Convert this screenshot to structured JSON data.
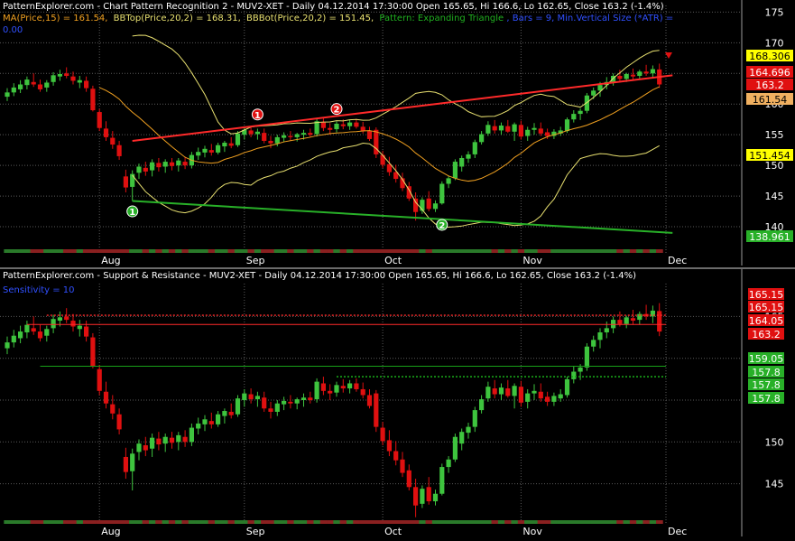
{
  "colors": {
    "background": "#000000",
    "grid": "#5a5a5a",
    "up": "#3ec43e",
    "down": "#e01010",
    "ma": "#f0a020",
    "bands": "#e8e070",
    "resistance": "#ff2a2a",
    "support": "#28b028",
    "flat_level": "#18a018",
    "text_white": "#ffffff",
    "text_gold": "#e8c840",
    "text_green": "#20b020",
    "text_blue": "#3050ff"
  },
  "top": {
    "title": "PatternExplorer.com - Chart Pattern Recognition 2 - MUV2-XET - Daily 04.12.2014 17:30:00 Open 165.65, Hi 166.6, Lo 162.65, Close 163.2 (-1.4%)",
    "ma_label": "MA(Price,15) = 161.54,",
    "bbtop_label": "BBTop(Price,20,2) = 168.31,",
    "bbbot_label": "BBBot(Price,20,2) = 151.45,",
    "pattern_label": "Pattern: Expanding Triangle",
    "bars_label": ", Bars = 9, Min.Vertical Size (*ATR) =",
    "atr_value": "0.00",
    "y_ticks": [
      "175",
      "170",
      "165",
      "160",
      "155",
      "150",
      "145",
      "140"
    ],
    "price_tags": [
      {
        "text": "168.306",
        "bg": "#ffff00",
        "fg": "#000000"
      },
      {
        "text": "164.696",
        "bg": "#e01010",
        "fg": "#ffffff"
      },
      {
        "text": "163.2",
        "bg": "#e01010",
        "fg": "#ffffff"
      },
      {
        "text": "161.54",
        "bg": "#f0b060",
        "fg": "#000000"
      },
      {
        "text": "151.454",
        "bg": "#ffff00",
        "fg": "#000000"
      },
      {
        "text": "138.961",
        "bg": "#28b028",
        "fg": "#ffffff"
      }
    ],
    "markers": [
      {
        "label": "1",
        "color": "#e01010"
      },
      {
        "label": "2",
        "color": "#e01010"
      },
      {
        "label": "1",
        "color": "#28b028"
      },
      {
        "label": "2",
        "color": "#28b028"
      }
    ]
  },
  "bottom": {
    "title": "PatternExplorer.com - Support & Resistance - MUV2-XET - Daily 04.12.2014 17:30:00 Open 165.65, Hi 166.6, Lo 162.65, Close 163.2 (-1.4%)",
    "sensitivity_label": "Sensitivity = 10",
    "y_ticks": [
      "165",
      "160",
      "155",
      "150",
      "145"
    ],
    "price_tags": [
      {
        "text": "165.15",
        "bg": "#e01010",
        "fg": "#ffffff"
      },
      {
        "text": "165.15",
        "bg": "#e01010",
        "fg": "#ffffff"
      },
      {
        "text": "164.05",
        "bg": "#e01010",
        "fg": "#ffffff"
      },
      {
        "text": "163.2",
        "bg": "#e01010",
        "fg": "#ffffff"
      },
      {
        "text": "159.05",
        "bg": "#28b028",
        "fg": "#ffffff"
      },
      {
        "text": "157.8",
        "bg": "#28b028",
        "fg": "#ffffff"
      },
      {
        "text": "157.8",
        "bg": "#28b028",
        "fg": "#ffffff"
      },
      {
        "text": "157.8",
        "bg": "#28b028",
        "fg": "#ffffff"
      }
    ]
  },
  "x_labels": [
    "Aug",
    "Sep",
    "Oct",
    "Nov",
    "Dec"
  ],
  "chart_data": [
    {
      "type": "candlestick",
      "title": "Chart Pattern Recognition 2 - MUV2-XET - Daily",
      "ylim": [
        137.5,
        175.5
      ],
      "x_months": {
        "Aug": 14,
        "Sep": 36,
        "Oct": 57,
        "Nov": 78,
        "Dec": 100
      },
      "series": [
        {
          "name": "MA(Price,15)",
          "last": 161.54
        },
        {
          "name": "BBTop(Price,20,2)",
          "last": 168.31
        },
        {
          "name": "BBBot(Price,20,2)",
          "last": 151.45
        }
      ],
      "resistance_line": {
        "from": [
          19,
          154.0
        ],
        "to": [
          101,
          164.7
        ]
      },
      "support_line": {
        "from": [
          19,
          144.2
        ],
        "to": [
          101,
          139.0
        ]
      },
      "pattern": "Expanding Triangle"
    },
    {
      "type": "candlestick",
      "title": "Support & Resistance - MUV2-XET - Daily",
      "ylim": [
        141.5,
        168.5
      ],
      "levels": [
        {
          "name": "resistance",
          "value": 165.15,
          "style": "dotted"
        },
        {
          "name": "resistance",
          "value": 164.05,
          "style": "solid"
        },
        {
          "name": "support",
          "value": 159.05,
          "style": "solid"
        },
        {
          "name": "support",
          "value": 157.8,
          "style": "dotted"
        }
      ]
    }
  ],
  "ohlc": [
    [
      161.2,
      162.6,
      160.5,
      161.9
    ],
    [
      161.9,
      163.4,
      161.3,
      162.7
    ],
    [
      162.4,
      163.9,
      161.8,
      163.2
    ],
    [
      163.1,
      164.5,
      162.4,
      164.0
    ],
    [
      163.6,
      165.0,
      162.8,
      163.2
    ],
    [
      163.2,
      164.0,
      162.0,
      162.4
    ],
    [
      162.7,
      163.9,
      162.0,
      163.5
    ],
    [
      163.6,
      165.2,
      163.0,
      164.7
    ],
    [
      164.5,
      165.6,
      163.8,
      164.9
    ],
    [
      165.0,
      166.0,
      164.2,
      164.6
    ],
    [
      164.5,
      165.3,
      163.2,
      163.8
    ],
    [
      163.5,
      164.6,
      162.6,
      163.9
    ],
    [
      163.8,
      164.5,
      162.0,
      162.6
    ],
    [
      162.5,
      163.0,
      158.8,
      159.0
    ],
    [
      158.7,
      159.2,
      155.6,
      156.1
    ],
    [
      156.0,
      157.2,
      154.0,
      154.6
    ],
    [
      154.5,
      155.6,
      152.7,
      153.4
    ],
    [
      153.3,
      154.0,
      150.9,
      151.5
    ],
    [
      148.2,
      149.3,
      145.6,
      146.4
    ],
    [
      146.5,
      149.2,
      144.2,
      148.6
    ],
    [
      148.8,
      150.3,
      147.8,
      149.8
    ],
    [
      149.6,
      150.6,
      148.3,
      149.0
    ],
    [
      149.2,
      151.0,
      148.2,
      150.5
    ],
    [
      150.4,
      151.2,
      149.0,
      149.7
    ],
    [
      149.8,
      151.0,
      148.8,
      150.6
    ],
    [
      150.5,
      151.2,
      149.2,
      149.9
    ],
    [
      150.0,
      151.2,
      149.0,
      150.8
    ],
    [
      150.6,
      151.4,
      149.4,
      150.0
    ],
    [
      150.0,
      152.2,
      149.5,
      151.7
    ],
    [
      151.6,
      152.9,
      150.9,
      152.2
    ],
    [
      152.1,
      153.2,
      151.3,
      152.7
    ],
    [
      152.5,
      153.5,
      151.6,
      152.1
    ],
    [
      152.1,
      153.7,
      151.8,
      153.3
    ],
    [
      153.1,
      154.0,
      152.2,
      153.7
    ],
    [
      153.6,
      154.6,
      152.8,
      153.2
    ],
    [
      153.3,
      155.6,
      153.0,
      155.2
    ],
    [
      155.0,
      156.3,
      154.2,
      155.8
    ],
    [
      155.7,
      156.4,
      154.6,
      155.1
    ],
    [
      155.1,
      156.0,
      154.2,
      155.5
    ],
    [
      155.3,
      156.0,
      153.6,
      154.0
    ],
    [
      154.0,
      154.8,
      152.8,
      153.6
    ],
    [
      153.6,
      155.0,
      153.1,
      154.6
    ],
    [
      154.5,
      155.4,
      153.8,
      154.9
    ],
    [
      154.8,
      155.6,
      154.0,
      154.6
    ],
    [
      154.6,
      155.3,
      153.9,
      155.1
    ],
    [
      155.0,
      155.8,
      154.2,
      155.3
    ],
    [
      155.3,
      156.0,
      154.6,
      155.0
    ],
    [
      155.1,
      157.6,
      154.7,
      157.2
    ],
    [
      157.0,
      157.8,
      155.6,
      156.1
    ],
    [
      156.1,
      156.9,
      155.0,
      155.8
    ],
    [
      155.9,
      157.2,
      155.4,
      156.8
    ],
    [
      156.7,
      157.5,
      155.9,
      156.4
    ],
    [
      156.4,
      157.4,
      155.8,
      157.0
    ],
    [
      157.0,
      157.6,
      156.0,
      156.3
    ],
    [
      156.3,
      157.1,
      155.2,
      155.6
    ],
    [
      155.6,
      156.3,
      154.0,
      154.3
    ],
    [
      155.8,
      156.2,
      151.2,
      151.8
    ],
    [
      151.7,
      152.4,
      149.6,
      150.1
    ],
    [
      150.2,
      151.4,
      148.3,
      148.9
    ],
    [
      148.9,
      150.1,
      147.2,
      147.8
    ],
    [
      147.9,
      148.8,
      145.8,
      146.3
    ],
    [
      146.6,
      147.3,
      144.2,
      144.6
    ],
    [
      144.6,
      145.6,
      141.0,
      142.4
    ],
    [
      142.6,
      144.8,
      142.1,
      144.4
    ],
    [
      144.6,
      145.8,
      142.5,
      142.9
    ],
    [
      142.9,
      144.3,
      142.4,
      143.8
    ],
    [
      143.8,
      147.4,
      143.6,
      147.0
    ],
    [
      147.0,
      148.3,
      146.3,
      147.9
    ],
    [
      147.9,
      151.0,
      147.6,
      150.6
    ],
    [
      149.8,
      151.6,
      149.0,
      151.2
    ],
    [
      151.1,
      152.3,
      150.4,
      151.8
    ],
    [
      151.8,
      154.2,
      151.2,
      153.8
    ],
    [
      153.8,
      155.6,
      153.4,
      155.1
    ],
    [
      155.2,
      157.2,
      154.8,
      156.6
    ],
    [
      156.4,
      157.4,
      155.2,
      155.7
    ],
    [
      155.7,
      157.0,
      155.0,
      156.5
    ],
    [
      156.4,
      157.4,
      155.3,
      155.5
    ],
    [
      155.5,
      157.0,
      154.0,
      156.7
    ],
    [
      156.6,
      157.3,
      154.2,
      154.7
    ],
    [
      154.8,
      156.3,
      154.0,
      155.8
    ],
    [
      155.8,
      156.9,
      155.0,
      156.1
    ],
    [
      156.0,
      157.0,
      154.8,
      155.2
    ],
    [
      155.4,
      156.0,
      154.3,
      154.8
    ],
    [
      154.8,
      155.9,
      154.3,
      155.5
    ],
    [
      155.2,
      156.3,
      154.8,
      155.7
    ],
    [
      155.6,
      157.8,
      155.3,
      157.5
    ],
    [
      157.5,
      159.0,
      157.0,
      158.4
    ],
    [
      158.4,
      159.3,
      157.4,
      158.9
    ],
    [
      158.9,
      161.8,
      158.5,
      161.4
    ],
    [
      161.4,
      162.7,
      160.8,
      162.2
    ],
    [
      162.2,
      163.6,
      161.2,
      163.1
    ],
    [
      163.1,
      164.4,
      162.4,
      163.6
    ],
    [
      163.6,
      165.0,
      163.0,
      164.6
    ],
    [
      164.6,
      165.6,
      163.8,
      164.1
    ],
    [
      164.1,
      165.1,
      163.6,
      164.9
    ],
    [
      164.8,
      165.8,
      164.0,
      164.5
    ],
    [
      164.6,
      165.6,
      164.0,
      165.3
    ],
    [
      165.3,
      166.4,
      164.6,
      165.0
    ],
    [
      165.0,
      166.3,
      164.2,
      165.7
    ],
    [
      165.65,
      166.6,
      162.65,
      163.2
    ]
  ]
}
